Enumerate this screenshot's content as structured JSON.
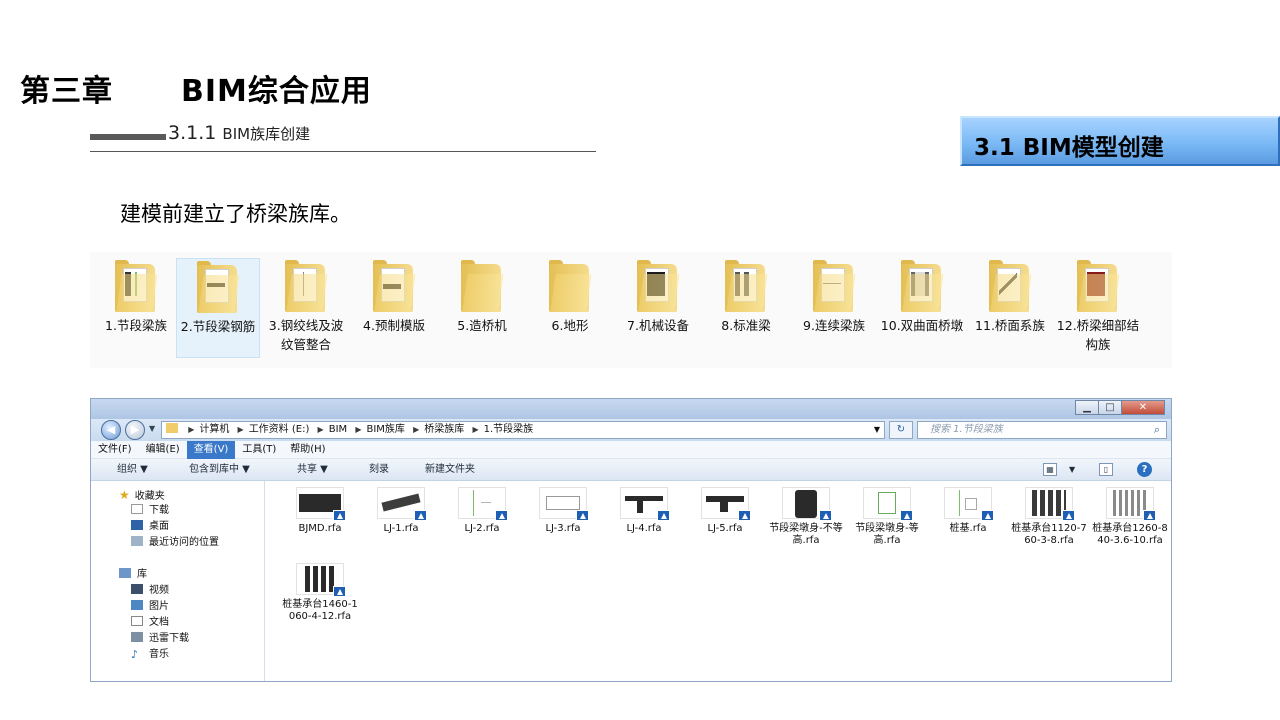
{
  "slide": {
    "chapter_label": "第三章",
    "chapter_name": "BIM综合应用",
    "subsection_number": "3.1.1",
    "subsection_text": "BIM族库创建",
    "section_banner": "3.1 BIM模型创建",
    "intro": "建模前建立了桥梁族库。"
  },
  "folder_strip": {
    "items": [
      {
        "label": "1.节段梁族"
      },
      {
        "label": "2.节段梁钢筋"
      },
      {
        "label": "3.钢绞线及波纹管整合"
      },
      {
        "label": "4.预制模版"
      },
      {
        "label": "5.造桥机"
      },
      {
        "label": "6.地形"
      },
      {
        "label": "7.机械设备"
      },
      {
        "label": "8.标准梁"
      },
      {
        "label": "9.连续梁族"
      },
      {
        "label": "10.双曲面桥墩"
      },
      {
        "label": "11.桥面系族"
      },
      {
        "label": "12.桥梁细部结构族"
      }
    ],
    "selected_index": 1
  },
  "explorer": {
    "window_buttons": {
      "minimize": "▁",
      "maximize": "□",
      "close": "✕"
    },
    "breadcrumb": [
      "计算机",
      "工作资料 (E:)",
      "BIM",
      "BIM族库",
      "桥梁族库",
      "1.节段梁族"
    ],
    "search_placeholder": "搜索 1.节段梁族",
    "menu": [
      "文件(F)",
      "编辑(E)",
      "查看(V)",
      "工具(T)",
      "帮助(H)"
    ],
    "active_menu": "查看(V)",
    "toolbar": {
      "organize": "组织 ▼",
      "include_library": "包含到库中 ▼",
      "share": "共享 ▼",
      "burn": "刻录",
      "new_folder": "新建文件夹",
      "help": "?"
    },
    "nav": {
      "favorites": "收藏夹",
      "favorites_items": [
        "下载",
        "桌面",
        "最近访问的位置"
      ],
      "libraries": "库",
      "library_items": [
        "视频",
        "图片",
        "文档",
        "迅雷下载",
        "音乐"
      ]
    },
    "files": [
      {
        "name": "BJMD.rfa"
      },
      {
        "name": "LJ-1.rfa"
      },
      {
        "name": "LJ-2.rfa"
      },
      {
        "name": "LJ-3.rfa"
      },
      {
        "name": "LJ-4.rfa"
      },
      {
        "name": "LJ-5.rfa"
      },
      {
        "name": "节段梁墩身-不等高.rfa"
      },
      {
        "name": "节段梁墩身-等高.rfa"
      },
      {
        "name": "桩基.rfa"
      },
      {
        "name": "桩基承台1120-760-3-8.rfa"
      },
      {
        "name": "桩基承台1260-840-3.6-10.rfa"
      },
      {
        "name": "桩基承台1460-1060-4-12.rfa"
      }
    ]
  },
  "colors": {
    "banner": "#7bb9f5",
    "folder": "#f0cd6a",
    "menu_active": "#3a78c9",
    "revit_badge": "#1e5fb4"
  }
}
